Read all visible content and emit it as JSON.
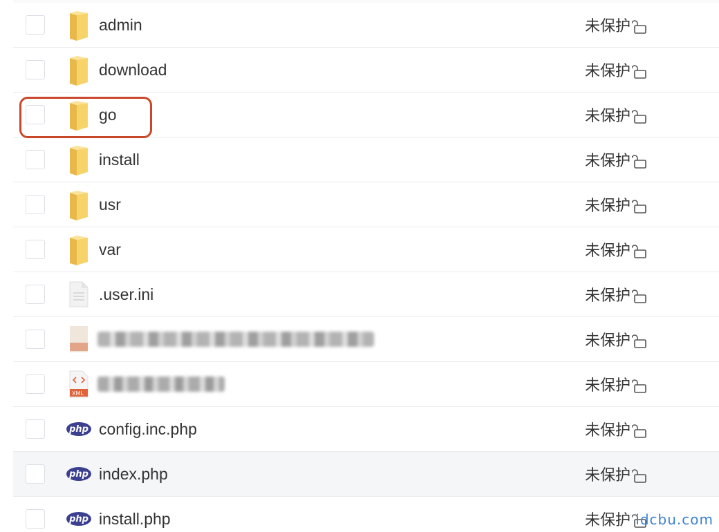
{
  "files": [
    {
      "name": "admin",
      "type": "folder",
      "protection": "未保护"
    },
    {
      "name": "download",
      "type": "folder",
      "protection": "未保护"
    },
    {
      "name": "go",
      "type": "folder",
      "protection": "未保护"
    },
    {
      "name": "install",
      "type": "folder",
      "protection": "未保护"
    },
    {
      "name": "usr",
      "type": "folder",
      "protection": "未保护"
    },
    {
      "name": "var",
      "type": "folder",
      "protection": "未保护"
    },
    {
      "name": ".user.ini",
      "type": "text-file",
      "protection": "未保护"
    },
    {
      "name": "",
      "type": "blurred-file",
      "protection": "未保护"
    },
    {
      "name": "",
      "type": "xml-file",
      "protection": "未保护"
    },
    {
      "name": "config.inc.php",
      "type": "php-file",
      "protection": "未保护"
    },
    {
      "name": "index.php",
      "type": "php-file",
      "protection": "未保护"
    },
    {
      "name": "install.php",
      "type": "php-file",
      "protection": "未保护"
    }
  ],
  "icons": {
    "folder": "folder-icon",
    "text_file": "text-file-icon",
    "xml_file": "xml-file-icon",
    "php_file": "php-file-icon",
    "lock": "unlocked-padlock-icon"
  },
  "labels": {
    "php_badge": "php",
    "xml_badge": "XML"
  },
  "watermark": "idcbu.com",
  "colors": {
    "highlight": "#c9472a",
    "folder": "#f7d46a",
    "php_badge": "#3a3f8f",
    "xml_badge": "#e0633a",
    "watermark": "#3b7fd4"
  }
}
